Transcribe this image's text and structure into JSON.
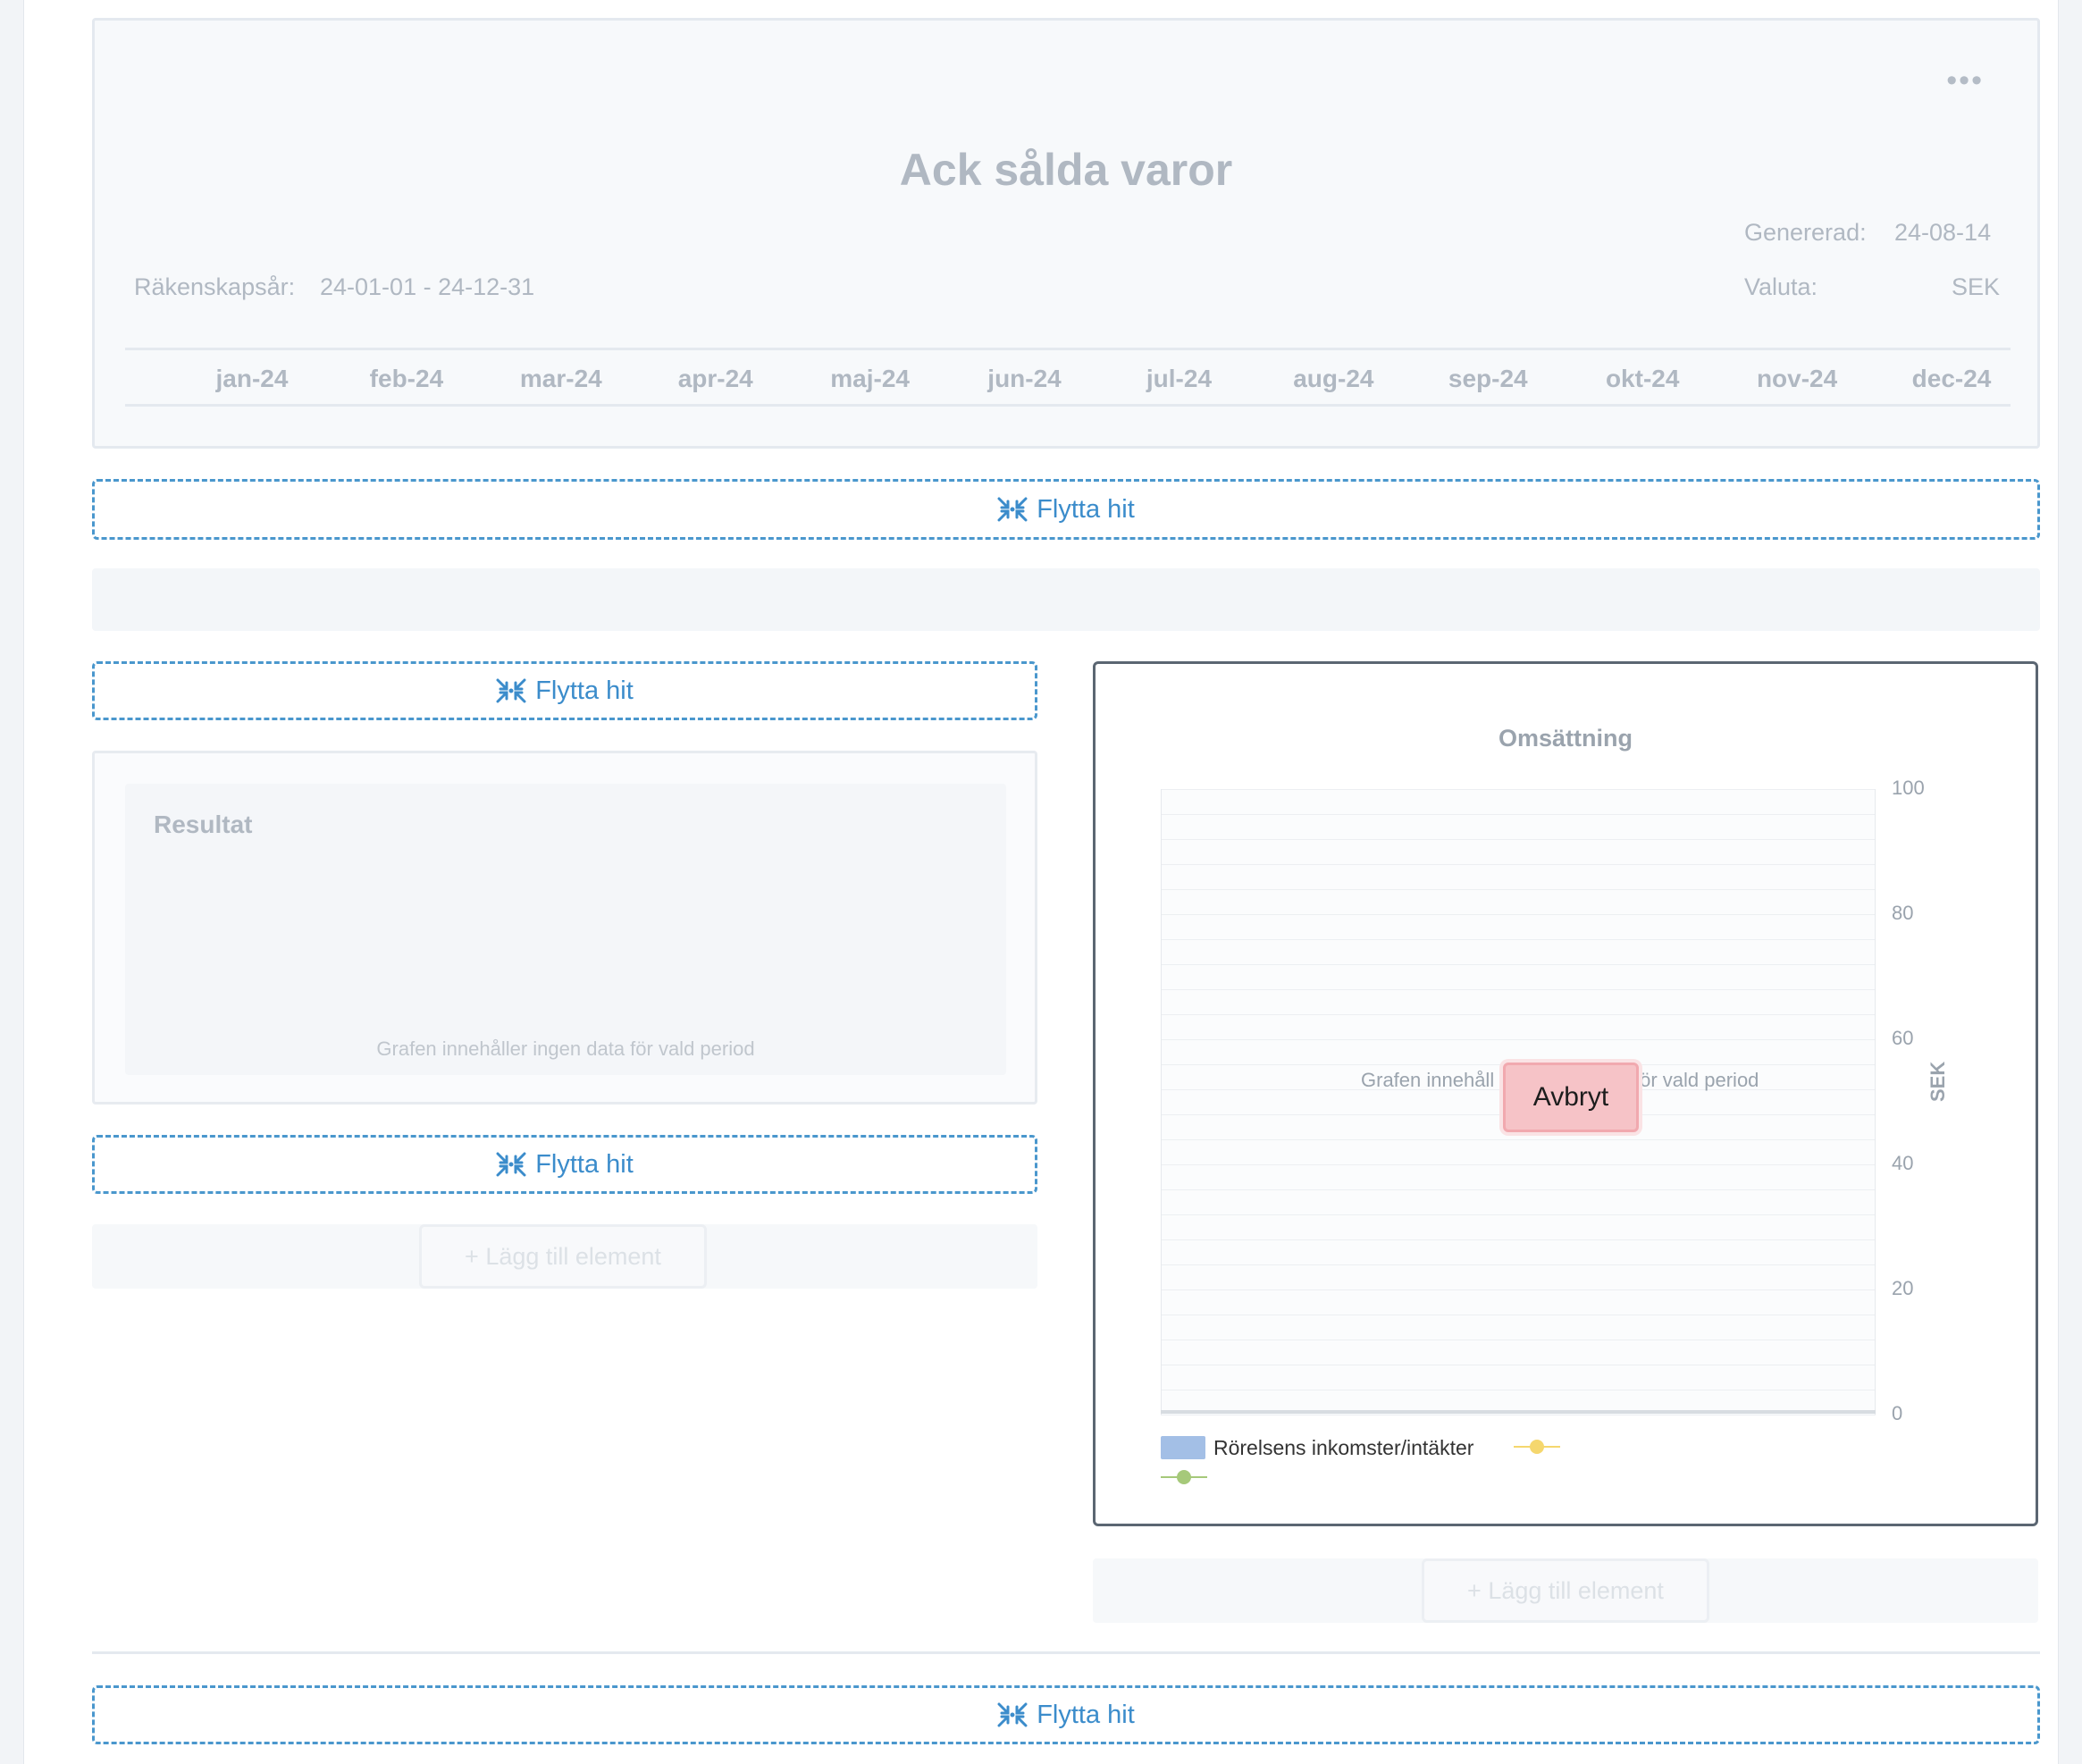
{
  "report": {
    "menu_glyph": "•••",
    "title": "Ack sålda varor",
    "generated_label": "Genererad:",
    "generated_value": "24-08-14",
    "fiscal_year_label": "Räkenskapsår:",
    "fiscal_year_value": "24-01-01 - 24-12-31",
    "currency_label": "Valuta:",
    "currency_value": "SEK",
    "months": [
      "jan-24",
      "feb-24",
      "mar-24",
      "apr-24",
      "maj-24",
      "jun-24",
      "jul-24",
      "aug-24",
      "sep-24",
      "okt-24",
      "nov-24",
      "dec-24"
    ]
  },
  "dropzones": {
    "label": "Flytta hit",
    "icon": "collapse-arrows-icon"
  },
  "result_widget": {
    "title": "Resultat",
    "empty_message": "Grafen innehåller ingen data för vald period"
  },
  "add_element": {
    "label": "+ Lägg till element"
  },
  "chart_widget": {
    "empty_message_left": "Grafen innehåll",
    "empty_message_right": "för vald period",
    "cancel_label": "Avbryt"
  },
  "colors": {
    "accent_blue": "#3b8ccb",
    "cancel_bg": "#f6c3c7",
    "series_bar": "#a3bfe6",
    "series_yellow": "#f5d76e",
    "series_green": "#a6c97a"
  },
  "chart_data": {
    "type": "bar",
    "title": "Omsättning",
    "ylabel": "SEK",
    "xlabel": "",
    "ylim": [
      0,
      100
    ],
    "yticks": [
      0,
      20,
      40,
      60,
      80,
      100
    ],
    "grid": true,
    "legend_position": "bottom-left",
    "categories": [],
    "series": [
      {
        "name": "Rörelsens inkomster/intäkter",
        "type": "bar",
        "color": "#a3bfe6",
        "values": []
      },
      {
        "type": "line",
        "color": "#f5d76e",
        "values": []
      },
      {
        "type": "line",
        "color": "#a6c97a",
        "values": []
      }
    ]
  }
}
